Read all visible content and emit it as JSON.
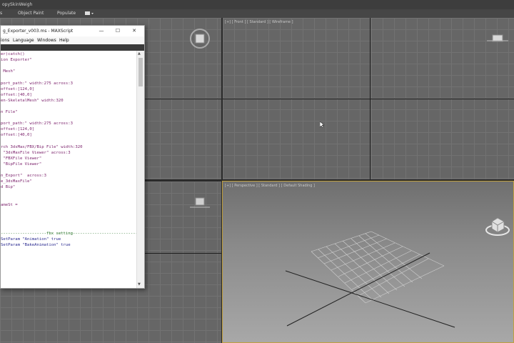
{
  "app": {
    "title": "opySkinWeigh"
  },
  "ribbon": {
    "items": [
      "s",
      "Object Paint",
      "Populate"
    ]
  },
  "viewports": {
    "top_right_label": "[+] [ Front ] [ Standard ] [ Wireframe ]",
    "perspective_label": "[+] [ Perspective ] [ Standard ] [ Default Shading ]"
  },
  "maxscript": {
    "title": "g_Exporter_v003.ms - MAXScript",
    "menus": [
      "ions",
      "Language",
      "Windows",
      "Help"
    ],
    "window_buttons": [
      "—",
      "☐",
      "✕"
    ],
    "code_lines": [
      "er)catch()",
      "ion Exporter\"",
      "",
      " Mesh\"",
      "",
      "port_path:\" width:275 across:3",
      "offset:[124,0]",
      "offset:[40,0]",
      "en-SkeletalMesh\" width:320",
      "",
      "n File\"",
      "",
      "port_path:\" width:275 across:3",
      "offset:[124,0]",
      "offset:[40,0]",
      "",
      "rch 3dsMax/FBX/Bip File\" width:320",
      " \"3dsMaxFile Viewer\" across:3",
      " \"FBXFile Viewer\"",
      " \"BipFile Viewer\"",
      "",
      "n_Export\"  across:3",
      "e_3dsMaxFile\"",
      "d Bip\"",
      "",
      "",
      "ameSt =",
      "",
      "",
      "",
      "",
      "-------------------fbx setting-----------------------------",
      "SetParam \"Animation\" true",
      "SetParam \"BakeAnimation\" true"
    ]
  }
}
